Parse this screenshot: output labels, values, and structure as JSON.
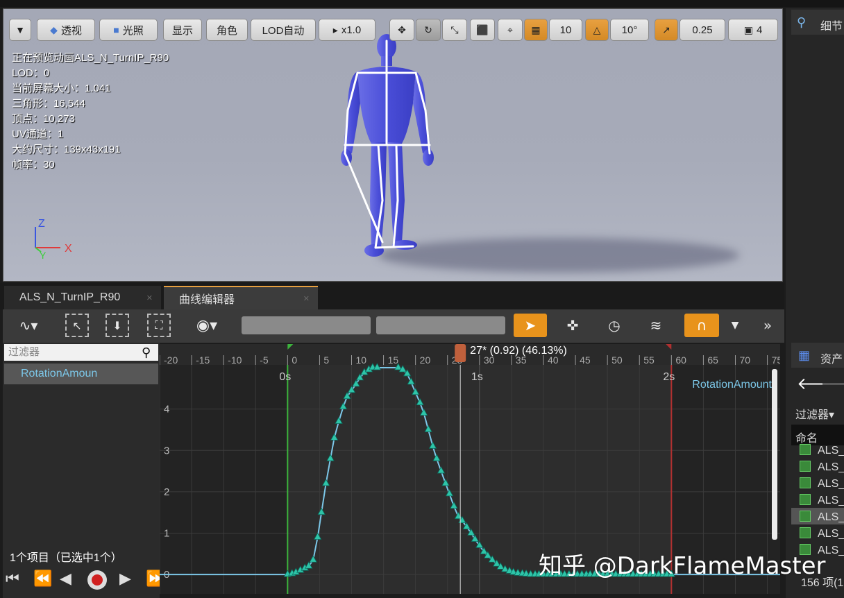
{
  "viewport": {
    "toolbar": {
      "perspective": "透视",
      "lighting": "光照",
      "show": "显示",
      "character": "角色",
      "lod_auto": "LOD自动",
      "speed": "x1.0",
      "grid_snap": "10",
      "angle_snap": "10°",
      "scale_snap": "0.25",
      "camera_speed": "4"
    },
    "stats": [
      "正在预览动画ALS_N_TurnIP_R90",
      "LOD：0",
      "当前屏幕大小：1.041",
      "三角形：16,544",
      "顶点：10,273",
      "UV通道：1",
      "大约尺寸：139x43x191",
      "帧率：30"
    ],
    "axes": {
      "z": "Z",
      "y": "Y",
      "x": "X"
    }
  },
  "tabs": [
    {
      "label": "ALS_N_TurnIP_R90"
    },
    {
      "label": "曲线编辑器"
    }
  ],
  "curve_list": {
    "filter_placeholder": "过滤器",
    "items": [
      "RotationAmoun"
    ],
    "count_text": "1个项目（已选中1个）"
  },
  "timeline": {
    "scrub_label": "27* (0.92) (46.13%)",
    "frame_ticks": [
      "-20",
      "-15",
      "-10",
      "-5",
      "0",
      "5",
      "10",
      "15",
      "20",
      "25",
      "30",
      "35",
      "40",
      "45",
      "50",
      "55",
      "60",
      "65",
      "70",
      "75"
    ],
    "second_labels": [
      "0s",
      "1s",
      "2s"
    ]
  },
  "chart_data": {
    "type": "line",
    "series": [
      {
        "name": "RotationAmount",
        "x": [
          0,
          0.7,
          1.3,
          2,
          2.7,
          3.3,
          4,
          4.7,
          5.3,
          6,
          6.7,
          7.3,
          8,
          8.7,
          9.3,
          10,
          10.7,
          11.3,
          12,
          12.7,
          13.3,
          14,
          17.3,
          18,
          18.7,
          19.3,
          20,
          20.7,
          21.3,
          22,
          22.7,
          23.3,
          24,
          24.7,
          25.3,
          26,
          26.7,
          27.3,
          28,
          28.7,
          29.3,
          30,
          30.7,
          31.3,
          32,
          32.7,
          33.3,
          34,
          34.7,
          35.3,
          36,
          36.7,
          37.3,
          38,
          38.7,
          39.3,
          40,
          40.7,
          41.3,
          42,
          42.7,
          43.3,
          44,
          44.7,
          45.3,
          46,
          46.7,
          47.3,
          48,
          48.7,
          49.3,
          50,
          50.7,
          51.3,
          52,
          52.7,
          53.3,
          54,
          54.7,
          55.3,
          56,
          56.7,
          57.3,
          58,
          58.7,
          59.3,
          60
        ],
        "y": [
          0,
          0.02,
          0.05,
          0.1,
          0.15,
          0.2,
          0.35,
          0.9,
          1.5,
          2.2,
          2.8,
          3.3,
          3.7,
          4.05,
          4.3,
          4.45,
          4.6,
          4.75,
          4.88,
          4.95,
          5.0,
          5.0,
          5.0,
          4.95,
          4.85,
          4.65,
          4.4,
          4.15,
          3.9,
          3.5,
          3.1,
          2.8,
          2.5,
          2.2,
          1.95,
          1.65,
          1.4,
          1.3,
          1.15,
          1.0,
          0.85,
          0.7,
          0.55,
          0.45,
          0.35,
          0.25,
          0.18,
          0.12,
          0.08,
          0.05,
          0.03,
          0.02,
          0.01,
          0,
          0,
          0,
          0,
          0,
          0,
          0,
          0,
          0,
          0,
          0,
          0,
          0,
          0,
          0,
          0,
          0,
          0,
          0,
          0,
          0,
          0,
          0,
          0,
          0,
          0,
          0,
          0,
          0,
          0,
          0,
          0,
          0,
          0
        ]
      }
    ],
    "xlabel": "",
    "ylabel": "",
    "xlim": [
      -20,
      77
    ],
    "ylim": [
      -0.4,
      5.0
    ],
    "y_ticks": [
      "0",
      "1",
      "2",
      "3",
      "4"
    ],
    "grid": true,
    "legend": "top-right",
    "colors": {
      "line": "#7cc7e8",
      "keys": "#2ec4a8",
      "start": "#3cb43c",
      "end": "#b03030",
      "playhead": "#d6d6d6"
    }
  },
  "right_panel": {
    "details": "细节",
    "assets": "资产",
    "filter": "过滤器",
    "name_header": "命名",
    "assets_list": [
      "ALS_",
      "ALS_",
      "ALS_",
      "ALS_",
      "ALS_",
      "ALS_",
      "ALS_"
    ],
    "count": "156 项(1"
  },
  "watermark": "知乎 @DarkFlameMaster"
}
